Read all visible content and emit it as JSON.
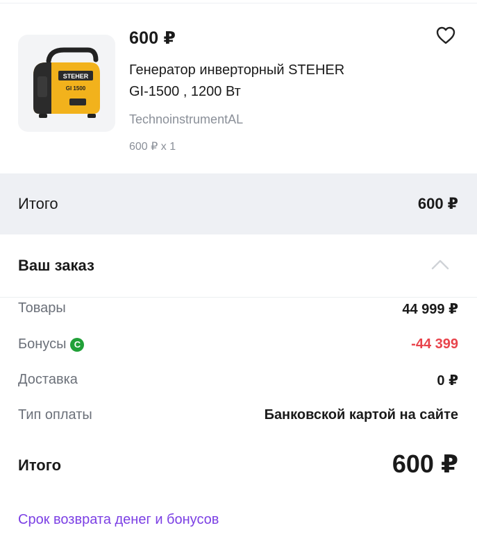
{
  "product": {
    "price": "600 ₽",
    "title_line1": "Генератор инверторный STEHER",
    "title_line2": "GI-1500 , 1200 Вт",
    "seller": "TechnoinstrumentAL",
    "qty": "600 ₽ x 1",
    "image_brand": "STEHER",
    "image_model": "GI 1500"
  },
  "total_band": {
    "label": "Итого",
    "value": "600 ₽"
  },
  "order": {
    "title": "Ваш заказ",
    "rows": [
      {
        "label": "Товары",
        "value": "44 999 ₽"
      },
      {
        "label": "Бонусы",
        "value": "-44 399"
      },
      {
        "label": "Доставка",
        "value": "0 ₽"
      },
      {
        "label": "Тип оплаты",
        "value": "Банковской картой на сайте"
      }
    ],
    "grand_label": "Итого",
    "grand_value": "600 ₽"
  },
  "return_link": "Срок возврата денег и бонусов",
  "colors": {
    "accent_link": "#7b3fe4",
    "negative": "#e8434b",
    "bonus": "#21a038",
    "band": "#eef0f4"
  }
}
